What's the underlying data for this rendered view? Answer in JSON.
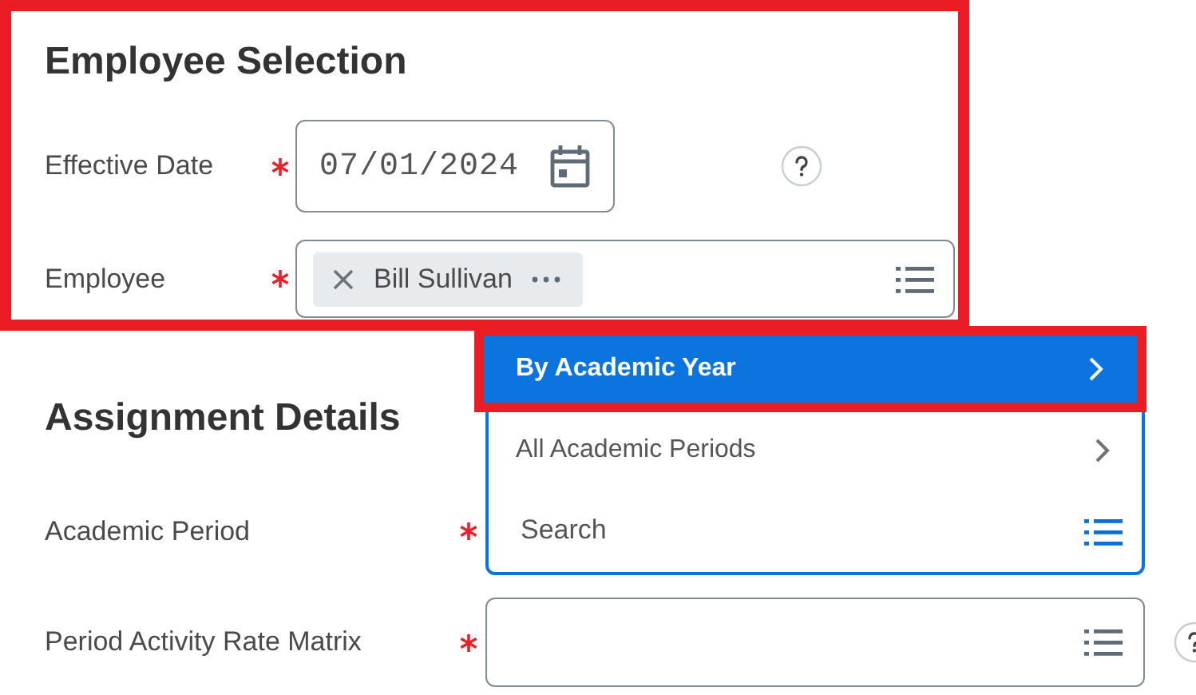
{
  "sections": [
    {
      "title": "Employee Selection",
      "highlighted": true,
      "fields": [
        {
          "kind": "date",
          "label": "Effective Date",
          "required": true,
          "value": "07/01/2024",
          "help": true
        },
        {
          "kind": "multiselect",
          "label": "Employee",
          "required": true,
          "tokens": [
            "Bill Sullivan"
          ]
        }
      ]
    },
    {
      "title": "Assignment Details",
      "fields": [
        {
          "kind": "prompt",
          "label": "Academic Period",
          "required": true,
          "placeholder": "Search",
          "focused": true,
          "menu": [
            {
              "label": "By Academic Year",
              "selected": true,
              "highlighted": true
            },
            {
              "label": "All Academic Periods",
              "selected": false,
              "highlighted": false
            }
          ]
        },
        {
          "kind": "prompt",
          "label": "Period Activity Rate Matrix",
          "required": true,
          "help": true,
          "focused": false
        }
      ]
    }
  ]
}
